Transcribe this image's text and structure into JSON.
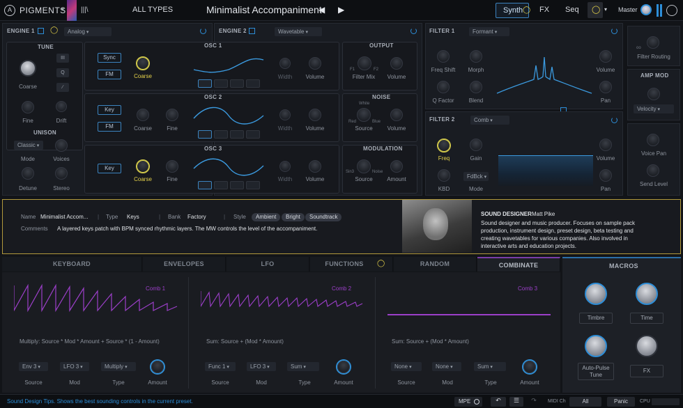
{
  "topbar": {
    "app_name": "PIGMENTS",
    "library_label": "|||\\",
    "all_types": "ALL TYPES",
    "preset_name": "Minimalist Accompaniment",
    "tabs": [
      "Synth",
      "FX",
      "Seq"
    ],
    "master": "Master"
  },
  "engine1": {
    "title": "ENGINE 1",
    "type": "Analog",
    "tune": "TUNE",
    "coarse": "Coarse",
    "fine": "Fine",
    "drift": "Drift",
    "unison": "UNISON",
    "unison_mode_value": "Classic",
    "mode": "Mode",
    "voices": "Voices",
    "detune": "Detune",
    "stereo": "Stereo",
    "waves": [
      "III",
      "Q"
    ]
  },
  "engine2": {
    "title": "ENGINE 2",
    "type": "Wavetable"
  },
  "osc": [
    {
      "title": "OSC 1",
      "btns": [
        "Sync",
        "FM"
      ],
      "knob1": "Coarse",
      "knob2": "Width",
      "knob3": "Volume"
    },
    {
      "title": "OSC 2",
      "btns": [
        "Key",
        "FM"
      ],
      "knob0": "Coarse",
      "knob1": "Fine",
      "knob2": "Width",
      "knob3": "Volume"
    },
    {
      "title": "OSC 3",
      "btns": [
        "Key"
      ],
      "knob0": "Coarse",
      "knob1": "Fine",
      "knob2": "Width",
      "knob3": "Volume"
    }
  ],
  "output": {
    "title": "OUTPUT",
    "filter_mix": "Filter Mix",
    "f1": "F1",
    "f2": "F2",
    "volume": "Volume"
  },
  "noise": {
    "title": "NOISE",
    "white": "White",
    "red": "Red",
    "blue": "Blue",
    "source": "Source",
    "volume": "Volume"
  },
  "modulation": {
    "title": "MODULATION",
    "sin": "Sin3",
    "noise": "Noise",
    "source": "Source",
    "amount": "Amount"
  },
  "filter1": {
    "title": "FILTER 1",
    "type": "Formant",
    "freq_shift": "Freq Shift",
    "morph": "Morph",
    "q_factor": "Q Factor",
    "blend": "Blend",
    "volume": "Volume",
    "pan": "Pan"
  },
  "filter2": {
    "title": "FILTER 2",
    "type": "Comb",
    "freq": "Freq",
    "gain": "Gain",
    "kbd": "KBD",
    "mode": "Mode",
    "mode_value": "FdBck",
    "volume": "Volume",
    "pan": "Pan"
  },
  "right_col": {
    "filter_routing": "Filter Routing",
    "amp_mod": "AMP MOD",
    "velocity": "Velocity",
    "voice_pan": "Voice Pan",
    "send_level": "Send Level"
  },
  "info": {
    "name_label": "Name",
    "name_value": "Minimalist Accom...",
    "type_label": "Type",
    "type_value": "Keys",
    "bank_label": "Bank",
    "bank_value": "Factory",
    "style_label": "Style",
    "styles": [
      "Ambient",
      "Bright",
      "Soundtrack"
    ],
    "comments_label": "Comments",
    "comments": "A layered keys patch with BPM synced rhythmic layers. The MW controls the level of the accompaniment.",
    "designer_label": "SOUND DESIGNER",
    "designer_name": "Matt Pike",
    "bio": [
      "Sound designer and music producer. Focuses on sample pack",
      "production, instrument design, preset design, beta testing and",
      "creating wavetables for various companies. Also involved in",
      "interactive arts and education projects."
    ]
  },
  "lower_tabs": [
    "KEYBOARD",
    "ENVELOPES",
    "LFO",
    "FUNCTIONS",
    "RANDOM",
    "COMBINATE"
  ],
  "macros": {
    "title": "MACROS",
    "items": [
      "Timbre",
      "Time",
      "Auto-Pulse Tune",
      "FX"
    ],
    "values": [
      0.55,
      0.7,
      0.45,
      0.5
    ]
  },
  "combs": [
    {
      "title": "Comb 1",
      "formula": "Multiply: Source * Mod * Amount + Source * (1 - Amount)",
      "dds": [
        "Env 3",
        "LFO 3",
        "Multiply"
      ],
      "labels": [
        "Source",
        "Mod",
        "Type",
        "Amount"
      ]
    },
    {
      "title": "Comb 2",
      "formula": "Sum: Source + (Mod * Amount)",
      "dds": [
        "Func 1",
        "LFO 3",
        "Sum"
      ],
      "labels": [
        "Source",
        "Mod",
        "Type",
        "Amount"
      ]
    },
    {
      "title": "Comb 3",
      "formula": "Sum: Source + (Mod * Amount)",
      "dds": [
        "None",
        "None",
        "Sum"
      ],
      "labels": [
        "Source",
        "Mod",
        "Type",
        "Amount"
      ]
    }
  ],
  "status": {
    "text": "Sound Design Tips. Shows the best sounding controls in the current preset.",
    "mpe": "MPE",
    "midi_ch": "MIDI Ch",
    "all": "All",
    "panic": "Panic",
    "cpu": "CPU"
  },
  "colors": {
    "accent": "#2d8ed8",
    "purple": "#9c3fc9",
    "yellow": "#e6d34a",
    "bg": "#121418"
  }
}
